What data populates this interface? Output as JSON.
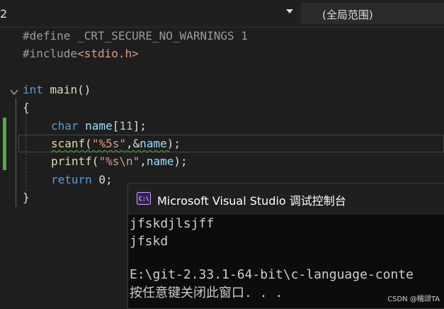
{
  "topbar": {
    "line_selector": "2",
    "scope_label": "(全局范围)"
  },
  "code": {
    "l1": {
      "a": "#define ",
      "b": "_CRT_SECURE_NO_WARNINGS",
      "c": " 1"
    },
    "l2": {
      "a": "#include",
      "b": "<stdio.h>"
    },
    "l4": {
      "a": "int",
      "b": " main",
      "c": "()"
    },
    "l5": {
      "a": "{"
    },
    "l6": {
      "a": "char",
      "b": " name",
      "c": "[",
      "d": "11",
      "e": "];"
    },
    "l7": {
      "a": "scanf",
      "b": "(",
      "c": "\"%5s\"",
      "d": ",&",
      "e": "name",
      "f": ");"
    },
    "l8": {
      "a": "printf",
      "b": "(",
      "c": "\"%s\\n\"",
      "d": ",",
      "e": "name",
      "f": ");"
    },
    "l9": {
      "a": "return",
      "b": " 0;"
    },
    "l10": {
      "a": "}"
    }
  },
  "console": {
    "title": "Microsoft Visual Studio 调试控制台",
    "lines": [
      "jfskdjlsjff",
      "jfskd",
      "",
      "E:\\git-2.33.1-64-bit\\c-language-conte",
      "按任意键关闭此窗口. . ."
    ]
  },
  "watermark": "CSDN @糯颂TA",
  "colors": {
    "keyword": "#569cd6",
    "string": "#d69d85",
    "macro": "#9b9b9b",
    "background": "#1e1e1e",
    "console_bg": "#0c0c0c"
  }
}
